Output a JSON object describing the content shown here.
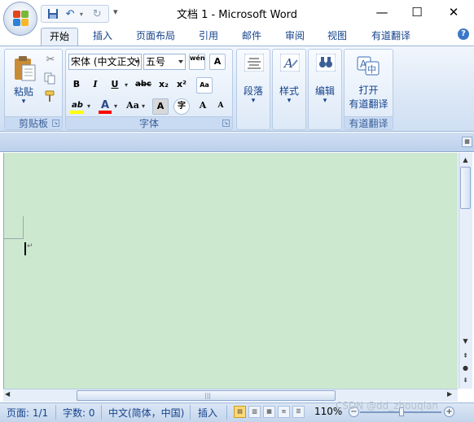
{
  "window": {
    "title": "文档 1 - Microsoft Word",
    "controls": [
      "minimize",
      "maximize",
      "close"
    ]
  },
  "quick_access": {
    "items": [
      "save-icon",
      "undo-icon",
      "redo-icon"
    ],
    "more_label": "▾"
  },
  "tabs": [
    {
      "label": "开始",
      "active": true
    },
    {
      "label": "插入"
    },
    {
      "label": "页面布局"
    },
    {
      "label": "引用"
    },
    {
      "label": "邮件"
    },
    {
      "label": "审阅"
    },
    {
      "label": "视图"
    },
    {
      "label": "有道翻译"
    }
  ],
  "help_label": "?",
  "ribbon": {
    "clipboard": {
      "group_label": "剪贴板",
      "paste_label": "粘贴",
      "paste_arrow": "▾"
    },
    "font": {
      "group_label": "字体",
      "font_name": "宋体 (中文正文)",
      "font_size": "五号",
      "buttons_row1": [
        "wén",
        "A"
      ],
      "buttons_row2": [
        "B",
        "I",
        "U",
        "abc",
        "x₂",
        "x²",
        "Aa"
      ],
      "buttons_row3": [
        "ab",
        "A",
        "Aa",
        "A",
        "字",
        "A",
        "A"
      ],
      "highlight_color": "#ffff00",
      "font_color": "#ff0000"
    },
    "paragraph": {
      "label": "段落",
      "arrow": "▾"
    },
    "styles": {
      "label": "样式",
      "arrow": "▾"
    },
    "editing": {
      "label": "编辑",
      "arrow": "▾"
    },
    "youdao": {
      "label_line1": "打开",
      "label_line2": "有道翻译",
      "group_label": "有道翻译"
    }
  },
  "statusbar": {
    "page": "页面: 1/1",
    "words": "字数: 0",
    "language": "中文(简体，中国)",
    "mode": "插入",
    "zoom": "110%"
  },
  "watermark": "CSDN @dd_zhouqian",
  "colors": {
    "document_background": "#cce8cf",
    "ribbon_accent": "#15428b"
  }
}
